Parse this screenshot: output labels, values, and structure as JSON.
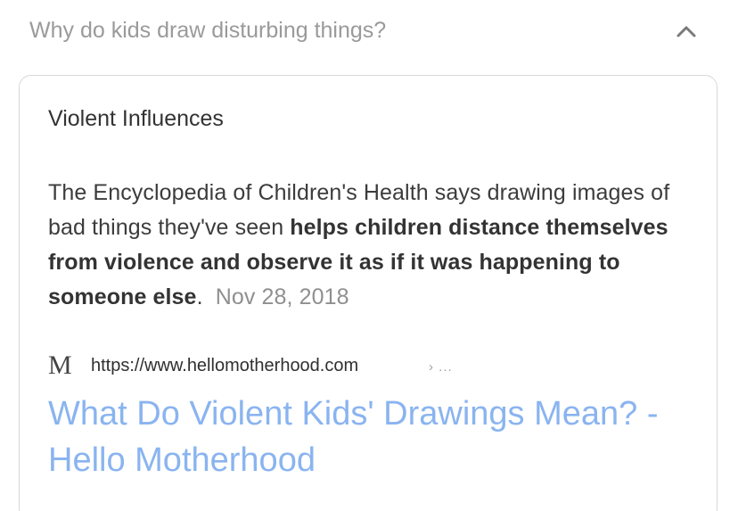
{
  "question": {
    "text": "Why do kids draw disturbing things?",
    "expanded": true,
    "toggle_icon": "chevron-up-icon"
  },
  "answer": {
    "heading": "Violent Influences",
    "snippet_intro": "The Encyclopedia of Children's Health says drawing images of bad things they've seen ",
    "snippet_bold": "helps children distance themselves from violence and observe it as if it was happening to someone else",
    "snippet_end": ".",
    "date": "Nov 28, 2018"
  },
  "source": {
    "favicon_letter": "M",
    "url": "https://www.hellomotherhood.com",
    "url_trail": "› ...",
    "title": "What Do Violent Kids' Drawings Mean? - Hello Motherhood"
  },
  "colors": {
    "question_text": "#9a9a9a",
    "link": "#8ab4f0",
    "date": "#8f8f8f",
    "card_border": "#d8d8d8"
  }
}
